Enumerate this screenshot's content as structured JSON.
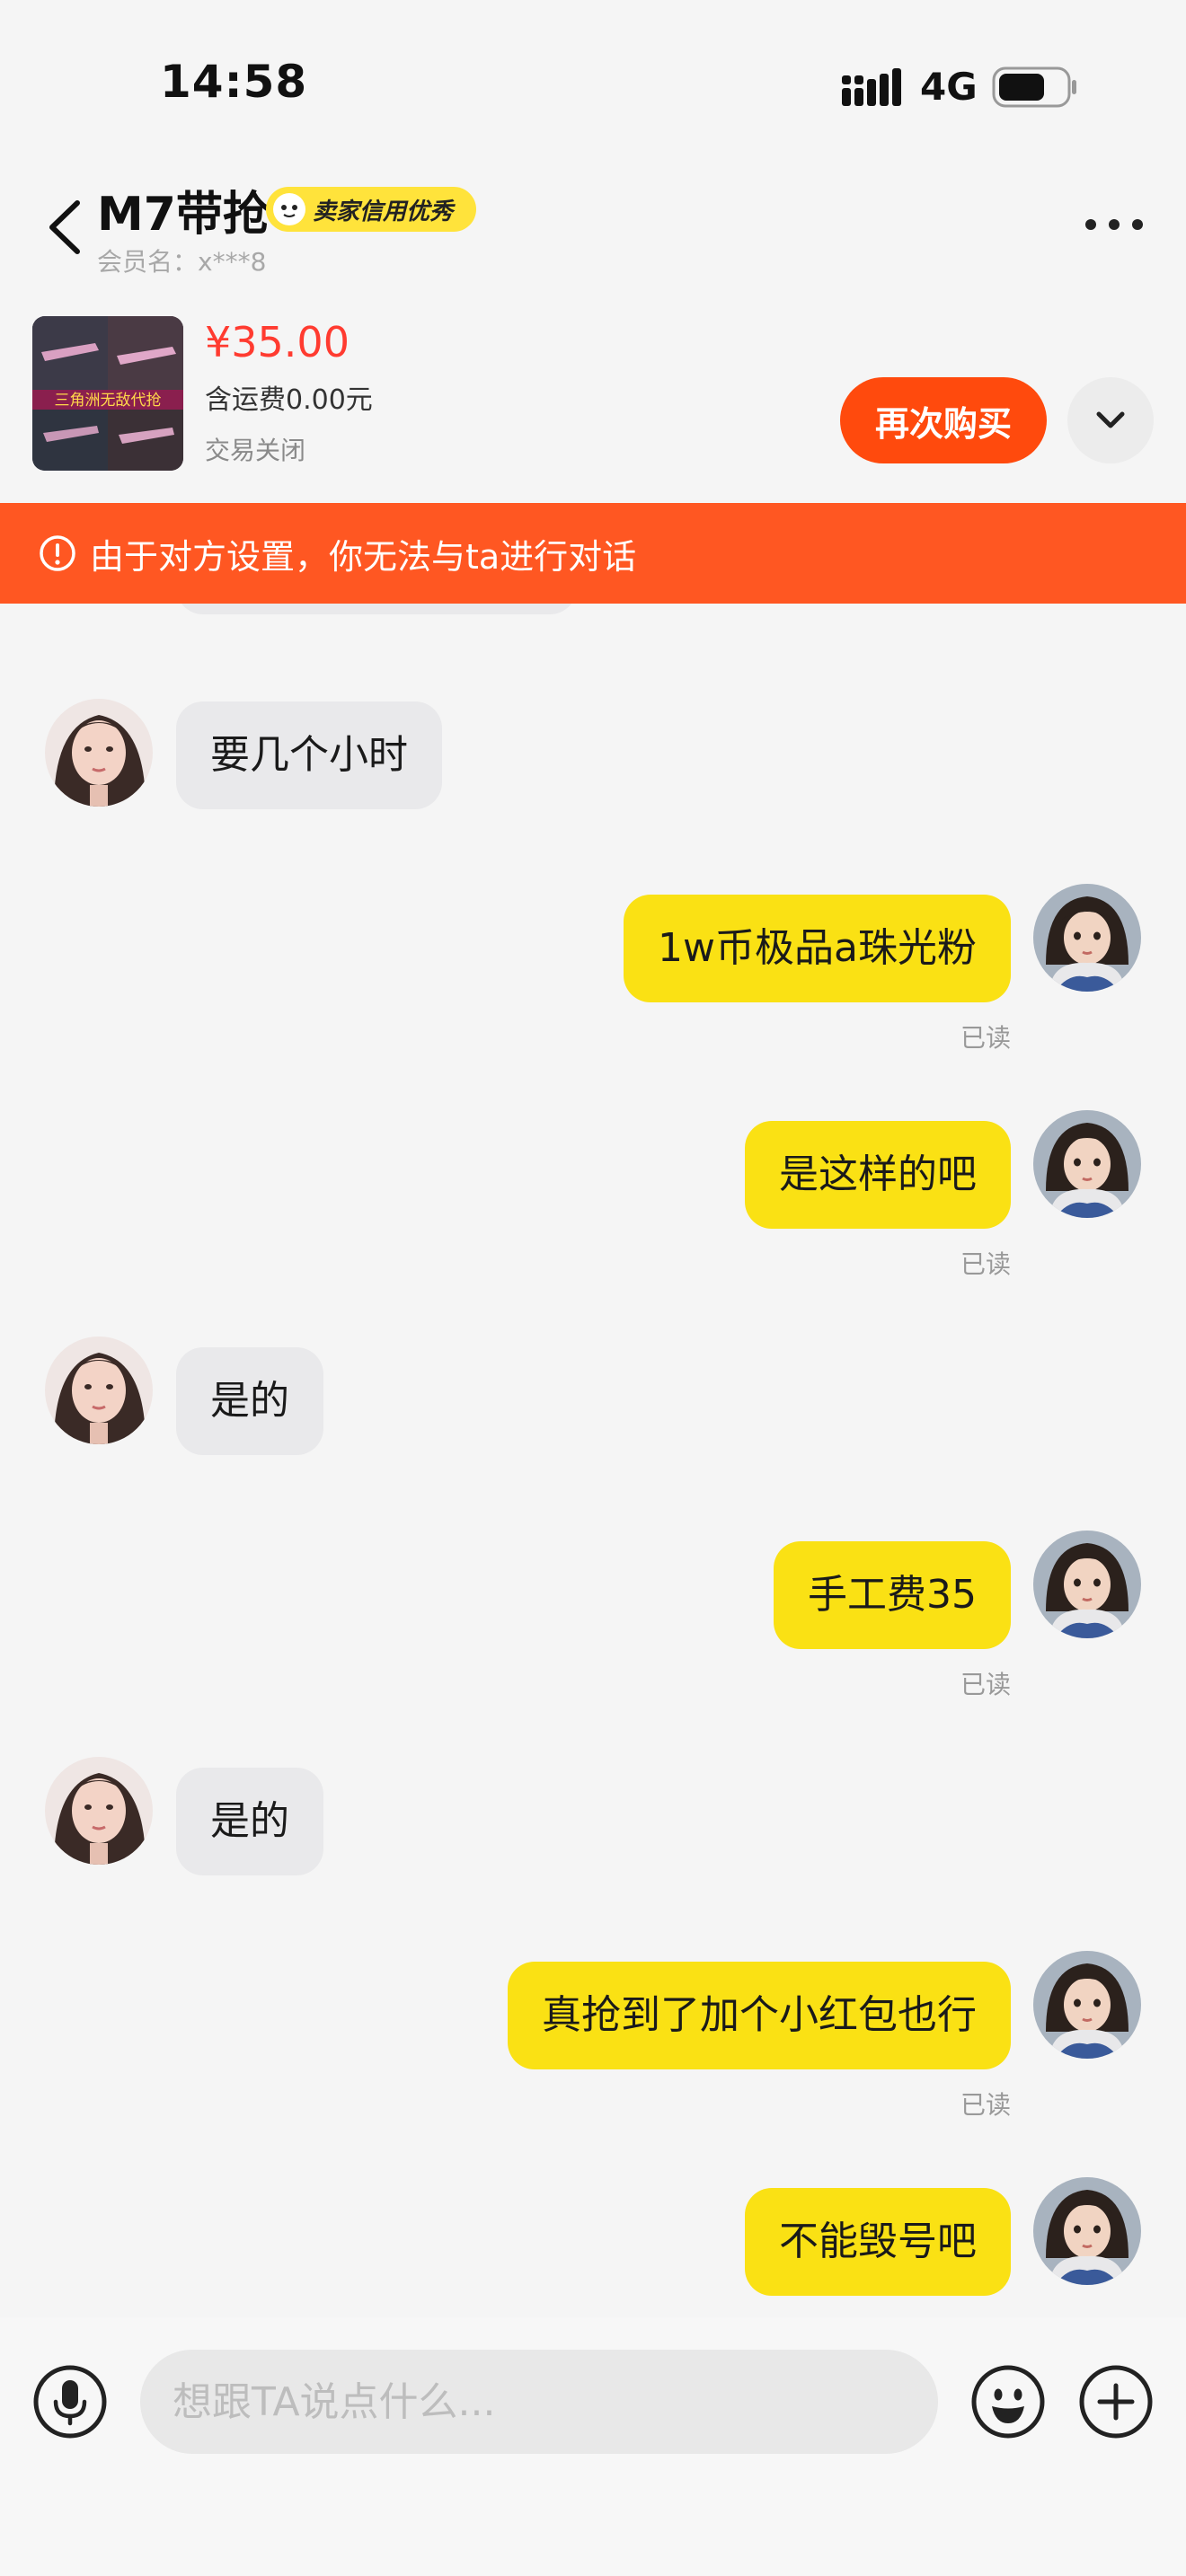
{
  "status_bar": {
    "time": "14:58",
    "network": "4G",
    "battery_level": 0.7
  },
  "header": {
    "title": "M7带抢",
    "badge": "卖家信用优秀",
    "member_label": "会员名：",
    "member_value": "x***8"
  },
  "product": {
    "price": "¥35.00",
    "shipping": "含运费0.00元",
    "status": "交易关闭",
    "rebuy_label": "再次购买",
    "thumb_caption": "三角洲无敌代抢"
  },
  "warning": {
    "text": "由于对方设置，你无法与ta进行对话"
  },
  "messages": [
    {
      "side": "in",
      "text": "要几个小时"
    },
    {
      "side": "out",
      "text": "1w币极品a珠光粉",
      "read": "已读"
    },
    {
      "side": "out",
      "text": "是这样的吧",
      "read": "已读"
    },
    {
      "side": "in",
      "text": "是的"
    },
    {
      "side": "out",
      "text": "手工费35",
      "read": "已读"
    },
    {
      "side": "in",
      "text": "是的"
    },
    {
      "side": "out",
      "text": "真抢到了加个小红包也行",
      "read": "已读"
    },
    {
      "side": "out",
      "text": "不能毁号吧"
    }
  ],
  "input": {
    "placeholder": "想跟TA说点什么..."
  },
  "colors": {
    "accent": "#ff4a0d",
    "warning_bg": "#ff5722",
    "outgoing_bubble": "#fae114",
    "incoming_bubble": "#e9e9eb",
    "price": "#ff3b30",
    "badge": "#ffe33b"
  },
  "icons": [
    "signal-icon",
    "battery-icon",
    "back-icon",
    "more-icon",
    "chevron-down-icon",
    "warning-icon",
    "mic-icon",
    "emoji-icon",
    "add-icon"
  ]
}
